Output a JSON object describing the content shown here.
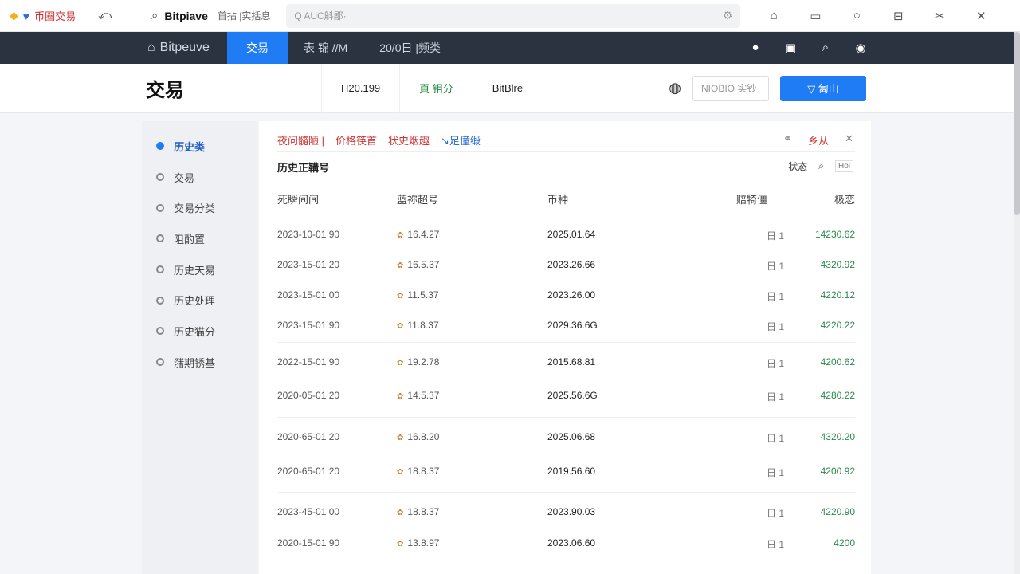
{
  "topbar": {
    "tab_title": "币圈交易",
    "back": "⤺",
    "brand": "Bitpiave",
    "brand_sub": "首拈 |实括息",
    "search_placeholder": "Q AUC斛鄙·",
    "icons": [
      "home-icon",
      "chat-icon",
      "bubble-icon",
      "window-icon",
      "link-icon",
      "close-icon"
    ]
  },
  "navbar": {
    "logo": "Bitpeuve",
    "items": [
      "交易",
      "表 锦 //M",
      "20/0日 |频类"
    ],
    "active_index": 0
  },
  "header": {
    "title": "交易",
    "stats": [
      "H20.199",
      "頁 钼分",
      "BitBlre"
    ],
    "input_placeholder": "NIOBIO 实钞",
    "button_label": "▽ 匐山"
  },
  "sidebar": {
    "items": [
      "历史类",
      "交易",
      "交易分类",
      "阻酌置",
      "历史天易",
      "历史处理",
      "历史猫分",
      "潴期锈基"
    ],
    "active_index": 0
  },
  "content": {
    "filters": [
      "夜问髓陋 |",
      "价格筷首",
      "状史烟趣",
      "↘足僮缎"
    ],
    "tool_label": "乡从",
    "sub_title": "历史正鞲号",
    "status_label": "状态",
    "tag_label": "Hoi",
    "columns": [
      "死瞬间间",
      "蓝祢超号",
      "币种",
      "赔犄僵",
      "极恋"
    ],
    "rows": [
      {
        "time": "2023-10-01 90",
        "code": "16.4.27",
        "coin": "2025.01.64",
        "qty": "日 1",
        "value": "14230.62"
      },
      {
        "time": "2023-15-01 20",
        "code": "16.5.37",
        "coin": "2023.26.66",
        "qty": "日 1",
        "value": "4320.92"
      },
      {
        "time": "2023-15-01 00",
        "code": "11.5.37",
        "coin": "2023.26.00",
        "qty": "日 1",
        "value": "4220.12"
      },
      {
        "time": "2023-15-01 90",
        "code": "11.8.37",
        "coin": "2029.36.6G",
        "qty": "日 1",
        "value": "4220.22"
      },
      {
        "time": "2022-15-01 90",
        "code": "19.2.78",
        "coin": "2015.68.81",
        "qty": "日 1",
        "value": "4200.62"
      },
      {
        "time": "2020-05-01 20",
        "code": "14.5.37",
        "coin": "2025.56.6G",
        "qty": "日 1",
        "value": "4280.22"
      },
      {
        "time": "2020-65-01 20",
        "code": "16.8.20",
        "coin": "2025.06.68",
        "qty": "日 1",
        "value": "4320.20"
      },
      {
        "time": "2020-65-01 20",
        "code": "18.8.37",
        "coin": "2019.56.60",
        "qty": "日 1",
        "value": "4200.92"
      },
      {
        "time": "2023-45-01 00",
        "code": "18.8.37",
        "coin": "2023.90.03",
        "qty": "日 1",
        "value": "4220.90"
      },
      {
        "time": "2020-15-01 90",
        "code": "13.8.97",
        "coin": "2023.06.60",
        "qty": "日 1",
        "value": "4200"
      }
    ]
  }
}
